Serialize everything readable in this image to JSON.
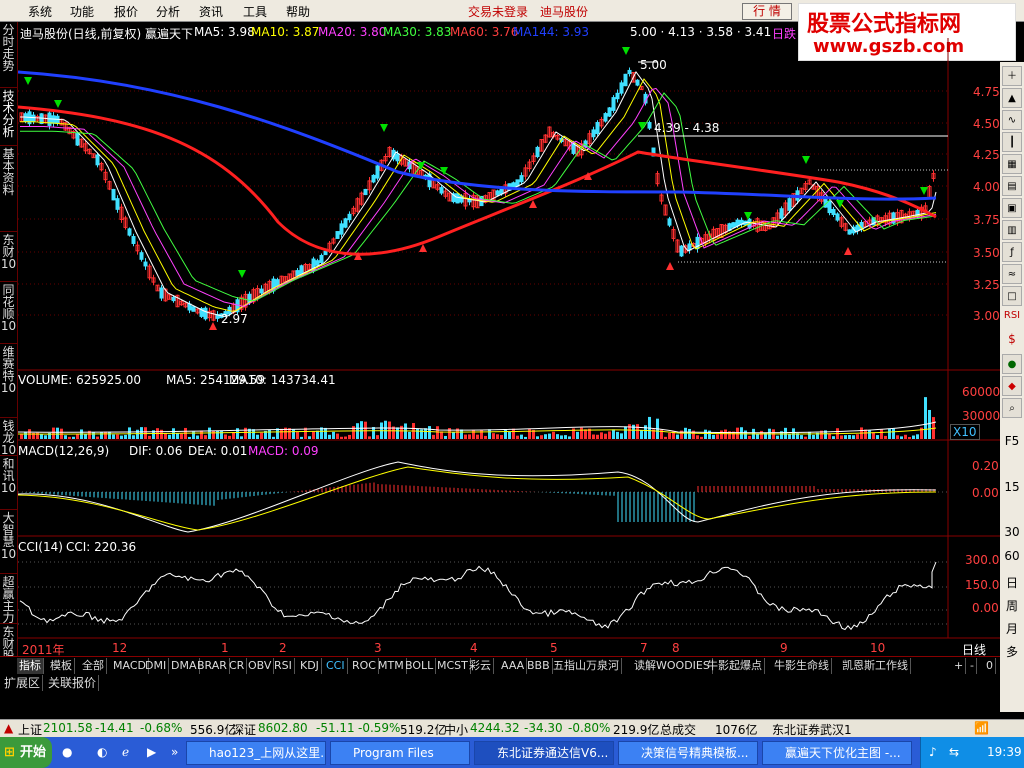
{
  "menu": [
    "系统",
    "功能",
    "报价",
    "分析",
    "资讯",
    "工具",
    "帮助"
  ],
  "top_status": {
    "login": "交易未登录",
    "stock": "迪马股份"
  },
  "hangqing_button": "行 情",
  "logo": {
    "line1": "股票公式指标网",
    "line2": "www.gszb.com"
  },
  "main_header": {
    "title": "迪马股份(日线,前复权) 赢遍天下",
    "ma5": "MA5: 3.98",
    "ma10": "MA10: 3.87",
    "ma20": "MA20: 3.80",
    "ma30": "MA30: 3.83",
    "ma60": "MA60: 3.76",
    "ma144": "MA144: 3.93",
    "right_label": "日跌"
  },
  "price_axis": [
    "4.75",
    "4.50",
    "4.25",
    "4.00",
    "3.75",
    "3.50",
    "3.25",
    "3.00"
  ],
  "price_annotations": {
    "high": "5.00",
    "low": "2.97",
    "range1": "5.00 · 4.13 · 3.58 · 3.41",
    "range2": "4.39 - 4.38"
  },
  "volume_header": {
    "label": "VOLUME: 625925.00",
    "ma5": "MA5: 254129.59",
    "ma10": "MA10: 143734.41"
  },
  "volume_axis": [
    "60000",
    "30000"
  ],
  "volume_unit": "X10",
  "macd_header": {
    "label": "MACD(12,26,9)",
    "dif": "DIF: 0.06",
    "dea": "DEA: 0.01",
    "macd": "MACD: 0.09"
  },
  "macd_axis": [
    "0.20",
    "0.00"
  ],
  "cci_header": {
    "label": "CCI(14)",
    "cci": "CCI: 220.36"
  },
  "cci_axis": [
    "300.0",
    "150.0",
    "0.00"
  ],
  "time_axis": [
    {
      "label": "2011年"
    },
    {
      "label": "12"
    },
    {
      "label": "1"
    },
    {
      "label": "2"
    },
    {
      "label": "3"
    },
    {
      "label": "4"
    },
    {
      "label": "5"
    },
    {
      "label": "7"
    },
    {
      "label": "8"
    },
    {
      "label": "9"
    },
    {
      "label": "10"
    }
  ],
  "period_label": "日线",
  "left_tabs": [
    "分时走势",
    "技术分析",
    "基本资料",
    "东财10",
    "同花顺10",
    "维赛特10",
    "钱龙10",
    "和讯10",
    "大智慧10",
    "超赢主力",
    "东财股吧"
  ],
  "indicator_tabs": [
    "指标",
    "模板",
    "全部",
    "MACD",
    "DMI",
    "DMA",
    "BRAR",
    "CR",
    "OBV",
    "RSI",
    "KDJ",
    "CCI",
    "ROC",
    "MTM",
    "BOLL",
    "MCST",
    "彩云",
    "AAA",
    "BBB",
    "五指山万泉河",
    "读解WOODIES",
    "牛影起爆点",
    "牛影生命线",
    "凯恩斯工作线"
  ],
  "tab_controls": [
    "+",
    "-",
    "0"
  ],
  "ext_tabs": [
    "扩展区",
    "关联报价"
  ],
  "right_panel": [
    "RSI",
    "$",
    "F5",
    "15",
    "30",
    "60",
    "日",
    "周",
    "月",
    "多"
  ],
  "status": {
    "sh_label": "上证",
    "sh_val": "2101.58",
    "sh_chg": "-14.41",
    "sh_pct": "-0.68%",
    "sh_amt": "556.9亿",
    "sz_label": "深证",
    "sz_val": "8602.80",
    "sz_chg": "-51.11",
    "sz_pct": "-0.59%",
    "sz_amt": "519.2亿",
    "zx_label": "中小",
    "zx_val": "4244.32",
    "zx_chg": "-34.30",
    "zx_pct": "-0.80%",
    "zx_amt": "219.9亿",
    "total_label": "总成交",
    "total_val": "1076亿",
    "broker": "东北证券武汉1"
  },
  "taskbar": {
    "start": "开始",
    "tasks": [
      "hao123_上网从这里...",
      "Program Files",
      "东北证券通达信V6...",
      "决策信号精典模板...",
      "赢遍天下优化主图 -..."
    ],
    "time": "19:39"
  }
}
